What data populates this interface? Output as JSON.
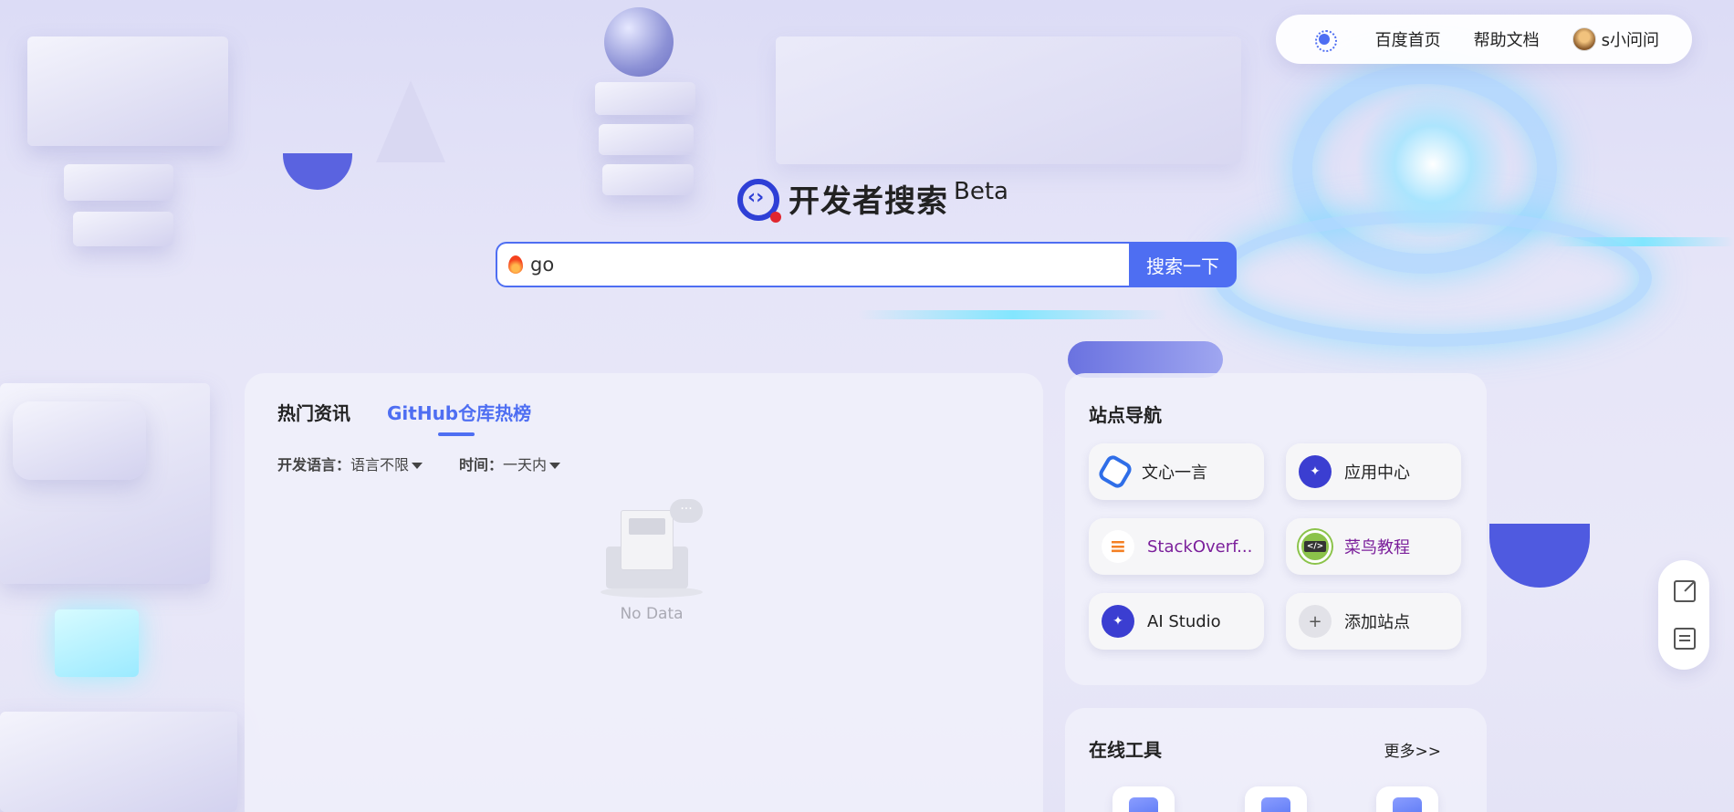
{
  "topnav": {
    "theme_icon": "sun-icon",
    "baidu_home": "百度首页",
    "help_docs": "帮助文档",
    "username": "s小问问"
  },
  "logo": {
    "name": "开发者搜索",
    "badge": "Beta"
  },
  "search": {
    "query": "go",
    "button_label": "搜索一下"
  },
  "feed": {
    "tabs": [
      {
        "label": "热门资讯",
        "active": false
      },
      {
        "label": "GitHub仓库热榜",
        "active": true
      }
    ],
    "filters": [
      {
        "label": "开发语言：",
        "value": "语言不限"
      },
      {
        "label": "时间：",
        "value": "一天内"
      }
    ],
    "empty_text": "No Data"
  },
  "site_nav": {
    "title": "站点导航",
    "items": [
      {
        "label": "文心一言",
        "icon": "wenxin-icon"
      },
      {
        "label": "应用中心",
        "icon": "app-center-icon"
      },
      {
        "label": "StackOverf...",
        "icon": "stackoverflow-icon"
      },
      {
        "label": "菜鸟教程",
        "icon": "runoob-icon"
      },
      {
        "label": "AI Studio",
        "icon": "ai-studio-icon"
      },
      {
        "label": "添加站点",
        "icon": "plus-icon"
      }
    ]
  },
  "tools": {
    "title": "在线工具",
    "more_label": "更多>>"
  },
  "colors": {
    "accent": "#4e6ef2",
    "visited": "#7b1f9b"
  }
}
